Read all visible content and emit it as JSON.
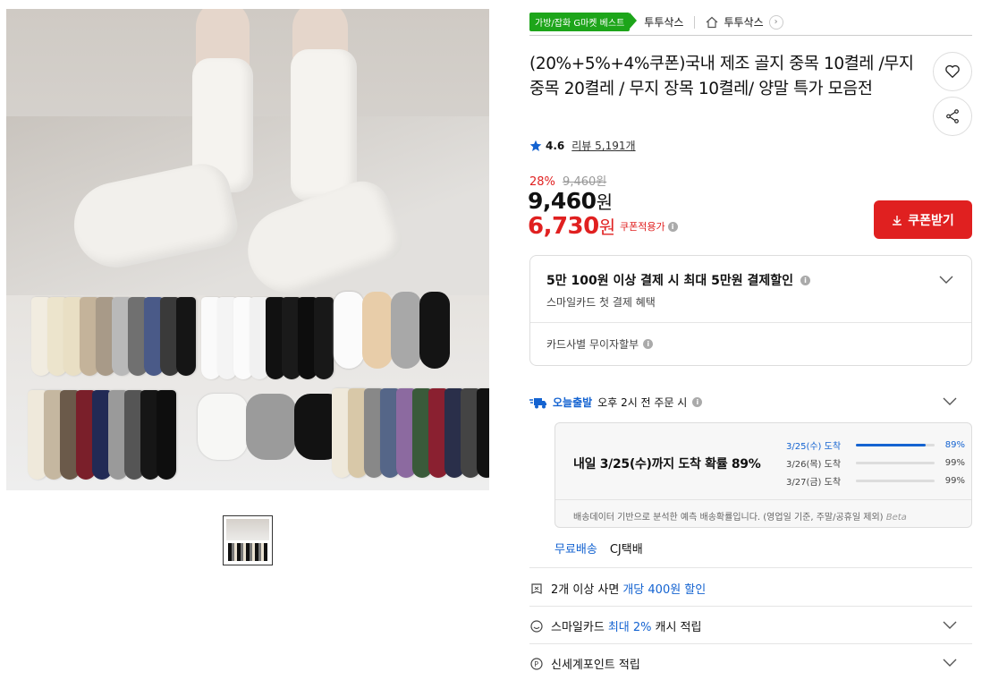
{
  "breadcrumb": {
    "badge": "가방/잡화 G마켓 베스트",
    "category": "투투삭스",
    "store": "투투삭스"
  },
  "product": {
    "title": "(20%+5%+4%쿠폰)국내 제조 골지 중목 10켤레 /무지 중목 20켤레 / 무지 장목 10켤레/ 양말 특가 모음전",
    "rating": "4.6",
    "review_label": "리뷰 5,191개",
    "discount_pct": "28%",
    "original_price": "9,460원",
    "price_num": "9,460",
    "coupon_price_num": "6,730",
    "won": "원",
    "coupon_note": "쿠폰적용가",
    "coupon_button": "쿠폰받기"
  },
  "card_benefit": {
    "headline": "5만 100원 이상 결제 시 최대 5만원 결제할인",
    "sub": "스마일카드 첫 결제 혜택",
    "installment": "카드사별 무이자할부"
  },
  "delivery": {
    "today_label": "오늘출발",
    "cutoff": "오후 2시 전 주문 시",
    "probability_text": "내일 3/25(수)까지 도착 확률 89%",
    "rows": [
      {
        "label": "3/25(수) 도착",
        "pct": "89%",
        "value": 89
      },
      {
        "label": "3/26(목) 도착",
        "pct": "99%",
        "value": 99
      },
      {
        "label": "3/27(금) 도착",
        "pct": "99%",
        "value": 99
      }
    ],
    "note": "배송데이터 기반으로 분석한 예측 배송확률입니다. (영업일 기준, 주말/공휴일 제외)",
    "beta": "Beta",
    "shipping_free": "무료배송",
    "carrier": "CJ택배"
  },
  "benefits": {
    "multi_prefix": "2개 이상 사면",
    "multi_highlight": "개당 400원 할인",
    "smile_prefix": "스마일카드",
    "smile_highlight": "최대 2%",
    "smile_suffix": "캐시 적립",
    "shinsegae": "신세계포인트 적립"
  },
  "colors": {
    "accent_red": "#e02020",
    "accent_blue": "#1463d1",
    "badge_green": "#1da51a"
  },
  "icons": [
    "heart-icon",
    "share-icon",
    "star-icon",
    "download-icon",
    "truck-icon",
    "chevron-down-icon",
    "home-icon",
    "info-icon",
    "coupon-icon",
    "smile-icon",
    "point-icon"
  ]
}
